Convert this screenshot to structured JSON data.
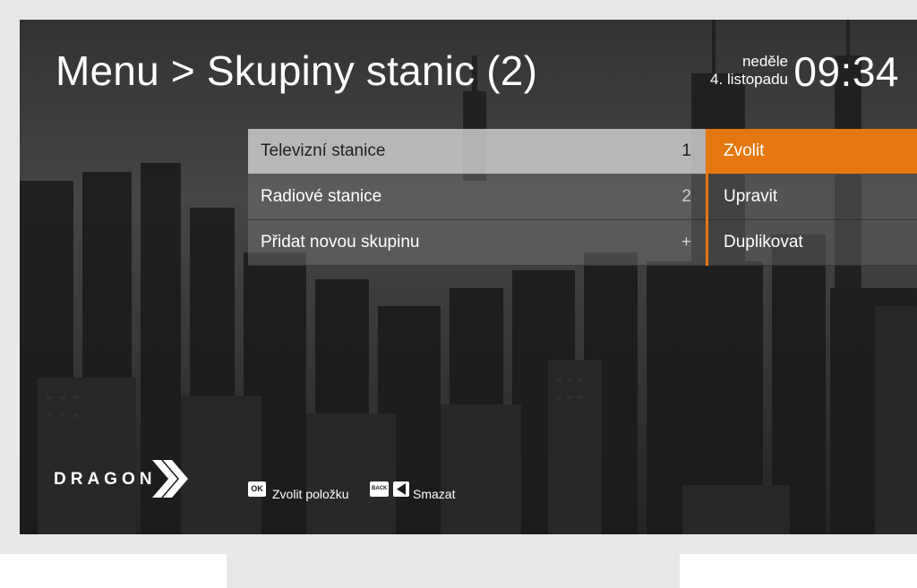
{
  "header": {
    "title": "Menu > Skupiny stanic (2)",
    "day": "neděle",
    "date": "4. listopadu",
    "time": "09:34"
  },
  "list": [
    {
      "label": "Televizní stanice",
      "value": "1",
      "selected": true
    },
    {
      "label": "Radiové stanice",
      "value": "2",
      "selected": false
    },
    {
      "label": "Přidat novou skupinu",
      "value": "+",
      "selected": false
    }
  ],
  "actions": [
    {
      "label": "Zvolit",
      "selected": true
    },
    {
      "label": "Upravit",
      "selected": false
    },
    {
      "label": "Duplikovat",
      "selected": false
    }
  ],
  "brand": {
    "name": "DRAGON"
  },
  "hints": [
    {
      "key": "OK",
      "key_icon": "ok-key-icon",
      "label": "Zvolit položku"
    },
    {
      "key": "BACK",
      "key_icon": "back-key-icon",
      "label": "Smazat"
    }
  ],
  "colors": {
    "accent": "#e4770f",
    "selected_row": "#d2d2d2",
    "text": "#ffffff"
  }
}
